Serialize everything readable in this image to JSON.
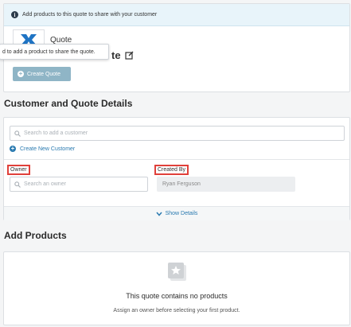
{
  "quote_card": {
    "banner_text": "Add products to this quote to share with your customer",
    "logo_label": "Quote",
    "title_fragment": "te",
    "tooltip_text": "d to add a product to share the quote.",
    "create_button_label": "Create Quote"
  },
  "customer_section": {
    "heading": "Customer and Quote Details",
    "search_placeholder": "Search to add a customer",
    "create_customer_label": "Create New Customer",
    "owner_label": "Owner",
    "owner_placeholder": "Search an owner",
    "created_by_label": "Created By",
    "created_by_value": "Ryan Ferguson",
    "show_details_label": "Show Details"
  },
  "products_section": {
    "heading": "Add Products",
    "empty_title": "This quote contains no products",
    "empty_subtitle": "Assign an owner before selecting your first product."
  },
  "colors": {
    "accent_blue": "#2a7ab0",
    "logo_blue": "#1f74c4",
    "button_disabled": "#8fb5c6",
    "highlight_red": "#e0403a"
  }
}
